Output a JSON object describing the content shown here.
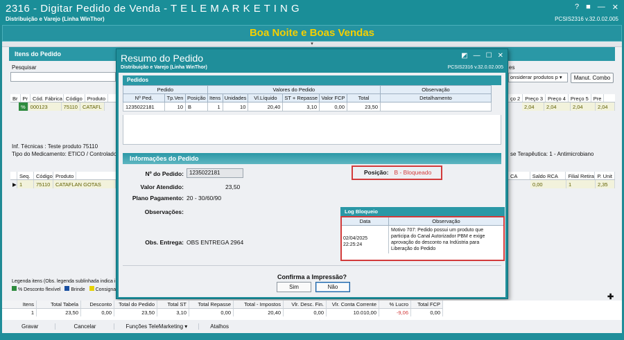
{
  "window": {
    "title": "2316 - Digitar Pedido de Venda - T E L E M A R K E T I N G",
    "subtitle": "Distribuição e Varejo (Linha WinThor)",
    "version": "PCSIS2316  v.32.0.02.005",
    "controls": [
      "?",
      "■",
      "—",
      "✕"
    ]
  },
  "banner": "Boa Noite e Boas Vendas",
  "colors": {
    "accent": "#1a8e98",
    "banner_text": "#f5d000",
    "alert_red": "#d23a3a"
  },
  "background": {
    "itens_title": "Itens do Pedido",
    "search_label": "Pesquisar",
    "search_suffix": "es",
    "considerar_label": "onsiderar produtos p",
    "manut_combo": "Manut. Combo",
    "grid_headers": [
      "Br",
      "Pr",
      "Cód. Fábrica",
      "Código",
      "Produto"
    ],
    "grid_row": [
      "%",
      "000123",
      "75110",
      "CATAFL"
    ],
    "price_headers": [
      "ço 2",
      "Preço 3",
      "Preço 4",
      "Preço 5",
      "Pre"
    ],
    "price_values": [
      "2,04",
      "2,04",
      "2,04",
      "2,04"
    ],
    "inf_tecnicas": "Inf. Técnicas : Teste produto 75110",
    "tipo_medicamento": "Tipo do Medicamento: ETICO / Controlado:",
    "classe_terapeutica": "se Terapêutica: 1 - Antimicrobiano",
    "item_headers": [
      "Seq.",
      "Código",
      "Produto"
    ],
    "item_row": [
      "1",
      "75110",
      "CATAFLAN GOTAS"
    ],
    "right_headers": [
      "CA",
      "Saldo RCA",
      "Filial Retira",
      "P. Unit"
    ],
    "right_values": [
      "0,00",
      "1",
      "2,35"
    ],
    "legend_text": "Legenda itens (Obs. legenda sublinhada indica inc",
    "legend_items": [
      "% Desconto flexível",
      "Brinde",
      "Consignado"
    ]
  },
  "modal": {
    "title": "Resumo do Pedido",
    "subtitle": "Distribuição e Varejo (Linha WinThor)",
    "version": "PCSIS2316  v.32.0.02.005",
    "pedidos_title": "Pedidos",
    "groups": [
      "Pedido",
      "Valores do Pedido",
      "Observação"
    ],
    "columns": [
      "Nº Ped.",
      "Tp.Ven",
      "Posição",
      "Itens",
      "Unidades",
      "Vl.Líquido",
      "ST + Repasse",
      "Valor FCP",
      "Total",
      "Detalhamento"
    ],
    "row": [
      "1235022181",
      "10",
      "B",
      "1",
      "10",
      "20,40",
      "3,10",
      "0,00",
      "23,50",
      ""
    ],
    "info_title": "Informações do Pedido",
    "num_pedido_label": "Nº do Pedido:",
    "num_pedido": "1235022181",
    "valor_atendido_label": "Valor Atendido:",
    "valor_atendido": "23,50",
    "plano_label": "Plano Pagamento:",
    "plano": "20 - 30/60/90",
    "observacoes_label": "Observações:",
    "obs_entrega_label": "Obs. Entrega:",
    "obs_entrega": "OBS ENTREGA 2964",
    "posicao_label": "Posição:",
    "posicao": "B - Bloqueado",
    "log_title": "Log Bloqueio",
    "log_columns": [
      "Data",
      "Observação"
    ],
    "log_date": "02/04/2025 22:25:24",
    "log_obs": "Motivo 707: Pedido possui um produto que participa do Canal Autorizador PBM e exige aprovação do desconto na Indústria para Liberação do Pedido",
    "confirm_text": "Confirma a Impressão?",
    "sim": "Sim",
    "nao": "Não"
  },
  "totals": {
    "headers": [
      "Itens",
      "Total Tabela",
      "Desconto",
      "Total do Pedido",
      "Total ST",
      "Total Repasse",
      "Total - Impostos",
      "Vlr. Desc. Fin.",
      "Vlr. Conta Corrente",
      "% Lucro",
      "Total FCP"
    ],
    "values": [
      "1",
      "23,50",
      "0,00",
      "23,50",
      "3,10",
      "0,00",
      "20,40",
      "0,00",
      "10.010,00",
      "-9,06",
      "0,00"
    ]
  },
  "bottom_buttons": [
    "Gravar",
    "Cancelar",
    "Funções TeleMarketing  ▾",
    "Atalhos"
  ]
}
